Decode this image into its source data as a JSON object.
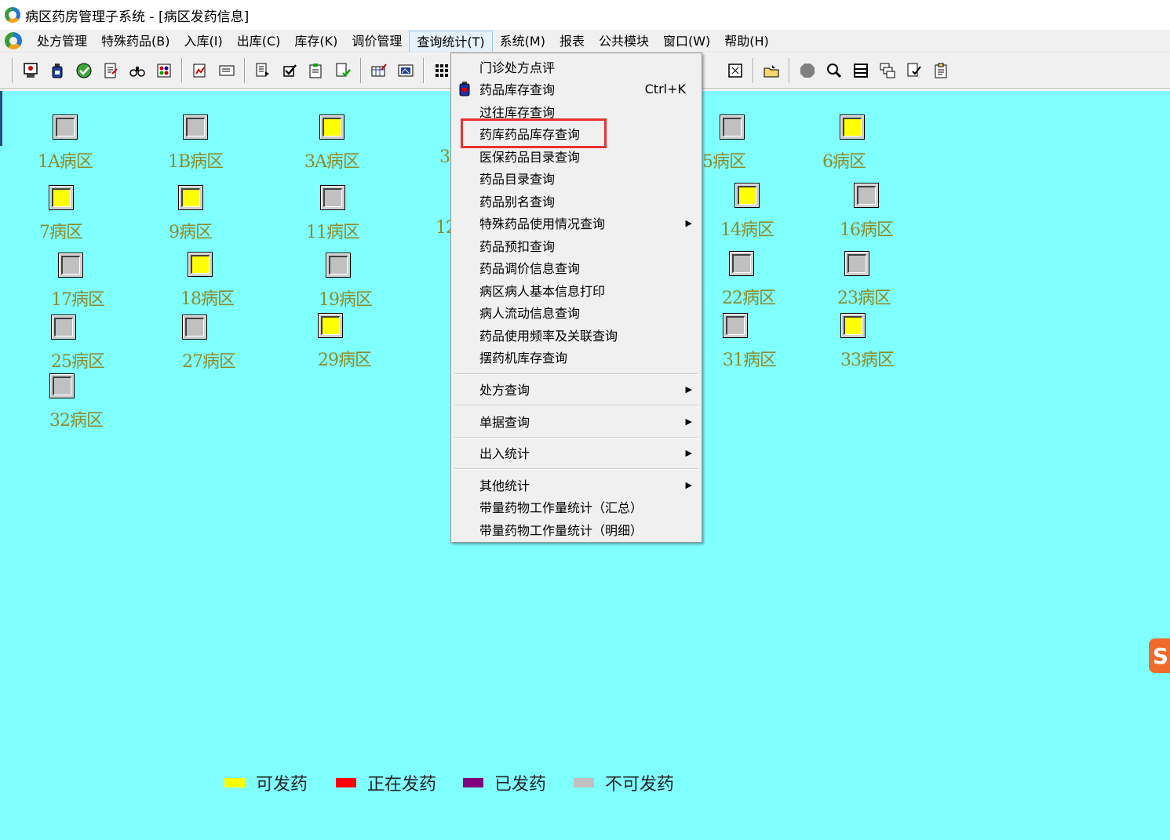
{
  "window": {
    "title": "病区药房管理子系统 - [病区发药信息]"
  },
  "menubar": {
    "items": [
      "处方管理",
      "特殊药品(B)",
      "入库(I)",
      "出库(C)",
      "库存(K)",
      "调价管理",
      "查询统计(T)",
      "系统(M)",
      "报表",
      "公共模块",
      "窗口(W)",
      "帮助(H)"
    ]
  },
  "dropdown": {
    "items": [
      {
        "label": "门诊处方点评"
      },
      {
        "label": "药品库存查询",
        "shortcut": "Ctrl+K"
      },
      {
        "label": "过往库存查询"
      },
      {
        "label": "药库药品库存查询"
      },
      {
        "label": "医保药品目录查询"
      },
      {
        "label": "药品目录查询"
      },
      {
        "label": "药品别名查询"
      },
      {
        "label": "特殊药品使用情况查询",
        "arrow": "▶"
      },
      {
        "label": "药品预扣查询"
      },
      {
        "label": "药品调价信息查询"
      },
      {
        "label": "病区病人基本信息打印"
      },
      {
        "label": "病人流动信息查询"
      },
      {
        "label": "药品使用频率及关联查询"
      },
      {
        "label": "摆药机库存查询"
      },
      {
        "label": "处方查询",
        "arrow": "▶"
      },
      {
        "label": "单据查询",
        "arrow": "▶"
      },
      {
        "label": "出入统计",
        "arrow": "▶"
      },
      {
        "label": "其他统计",
        "arrow": "▶"
      },
      {
        "label": "带量药物工作量统计（汇总）"
      },
      {
        "label": "带量药物工作量统计（明细）"
      }
    ]
  },
  "wards": [
    {
      "label": "1A病区",
      "status": "unavail"
    },
    {
      "label": "1B病区",
      "status": "unavail"
    },
    {
      "label": "3A病区",
      "status": "avail"
    },
    {
      "label": "3",
      "status": ""
    },
    {
      "label": "5病区",
      "status": "unavail"
    },
    {
      "label": "6病区",
      "status": "avail"
    },
    {
      "label": "7病区",
      "status": "avail"
    },
    {
      "label": "9病区",
      "status": "avail"
    },
    {
      "label": "11病区",
      "status": "unavail"
    },
    {
      "label": "12",
      "status": ""
    },
    {
      "label": "14病区",
      "status": "avail"
    },
    {
      "label": "16病区",
      "status": "unavail"
    },
    {
      "label": "17病区",
      "status": "unavail"
    },
    {
      "label": "18病区",
      "status": "avail"
    },
    {
      "label": "19病区",
      "status": "unavail"
    },
    {
      "label": "22病区",
      "status": "unavail"
    },
    {
      "label": "23病区",
      "status": "unavail"
    },
    {
      "label": "25病区",
      "status": "unavail"
    },
    {
      "label": "27病区",
      "status": "unavail"
    },
    {
      "label": "29病区",
      "status": "avail"
    },
    {
      "label": "31病区",
      "status": "unavail"
    },
    {
      "label": "33病区",
      "status": "avail"
    },
    {
      "label": "32病区",
      "status": "unavail"
    }
  ],
  "legend": [
    {
      "label": "可发药",
      "color": "#ffff00"
    },
    {
      "label": "正在发药",
      "color": "#ff0000"
    },
    {
      "label": "已发药",
      "color": "#800080"
    },
    {
      "label": "不可发药",
      "color": "#c0c0c0"
    }
  ],
  "side_logo": "S"
}
